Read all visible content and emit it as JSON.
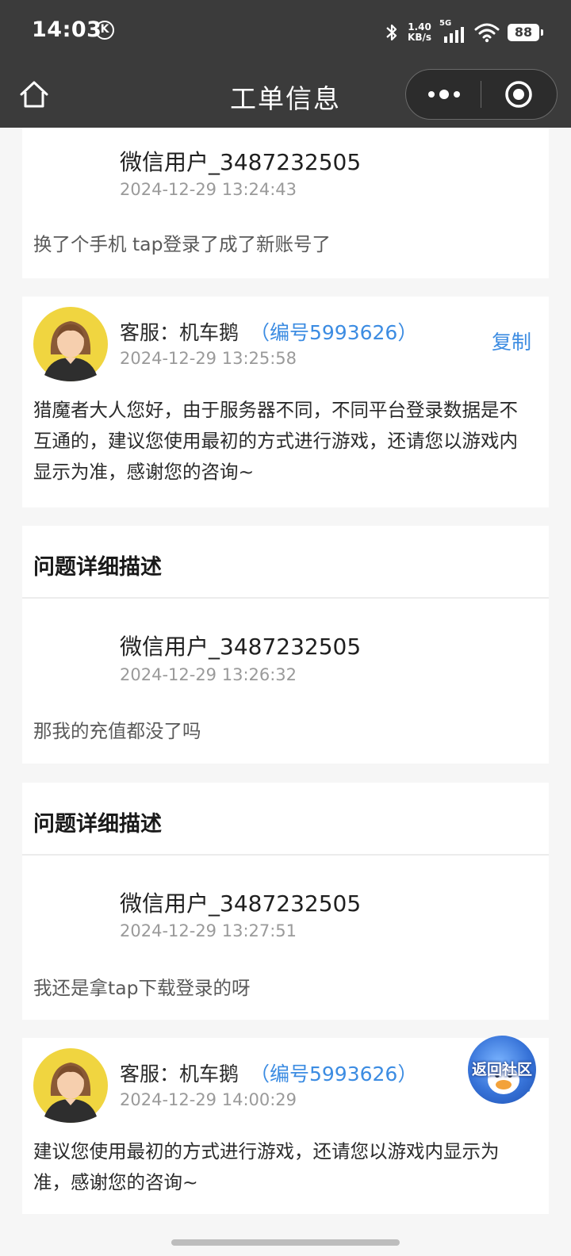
{
  "status_bar": {
    "time": "14:03",
    "carrier_icon_letter": "K",
    "net_speed_value": "1.40",
    "net_speed_unit": "KB/s",
    "signal_type": "5G",
    "battery": "88",
    "icons": [
      "bluetooth-icon",
      "signal-icon",
      "wifi-icon",
      "battery-icon"
    ]
  },
  "nav": {
    "title": "工单信息",
    "home_icon": "home-icon",
    "more_icon": "more-dots-icon",
    "close_icon": "target-icon"
  },
  "thread": {
    "messages": [
      {
        "type": "user",
        "name": "微信用户_3487232505",
        "time": "2024-12-29 13:24:43",
        "text": "换了个手机  tap登录了成了新账号了"
      },
      {
        "type": "staff",
        "name": "客服：机车鹅",
        "staff_id": "（编号5993626）",
        "copy_label": "复制",
        "time": "2024-12-29 13:25:58",
        "text": "猎魔者大人您好，由于服务器不同，不同平台登录数据是不互通的，建议您使用最初的方式进行游戏，还请您以游戏内显示为准，感谢您的咨询~"
      },
      {
        "type": "user",
        "section_title": "问题详细描述",
        "name": "微信用户_3487232505",
        "time": "2024-12-29 13:26:32",
        "text": "那我的充值都没了吗"
      },
      {
        "type": "user",
        "section_title": "问题详细描述",
        "name": "微信用户_3487232505",
        "time": "2024-12-29 13:27:51",
        "text": "我还是拿tap下载登录的呀"
      },
      {
        "type": "staff",
        "name": "客服：机车鹅",
        "staff_id": "（编号5993626）",
        "time": "2024-12-29 14:00:29",
        "text": "建议您使用最初的方式进行游戏，还请您以游戏内显示为准，感谢您的咨询~"
      }
    ]
  },
  "floating_button": {
    "label": "返回社区",
    "partial_copy_label": "制"
  },
  "colors": {
    "header_bg": "#3b3b3b",
    "page_bg": "#f6f6f6",
    "link_blue": "#3c8ce2",
    "avatar_bg": "#f0d540"
  }
}
